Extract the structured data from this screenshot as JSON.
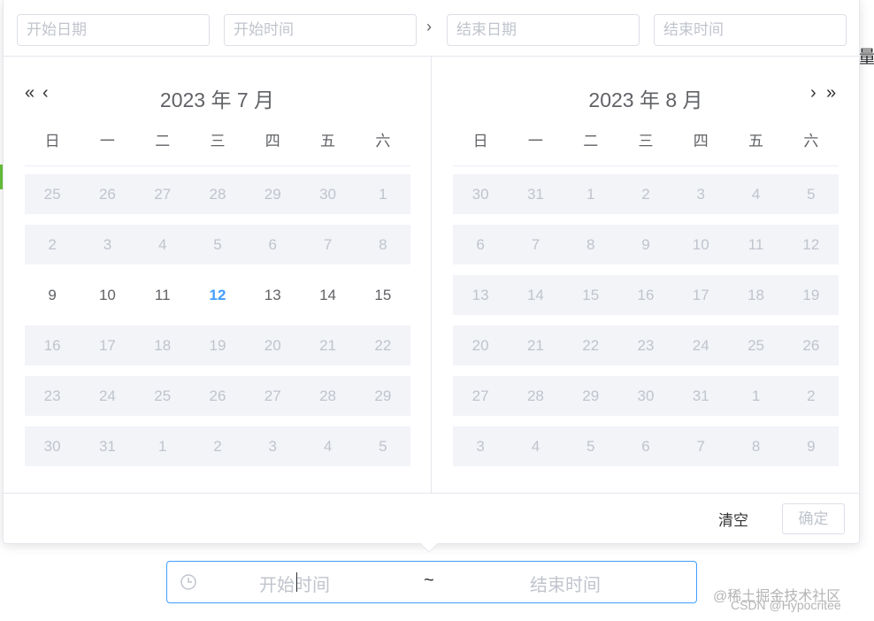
{
  "header": {
    "start_date_placeholder": "开始日期",
    "start_time_placeholder": "开始时间",
    "separator": "›",
    "end_date_placeholder": "结束日期",
    "end_time_placeholder": "结束时间"
  },
  "nav": {
    "prev_year": "«",
    "prev_month": "‹",
    "next_month": "›",
    "next_year": "»"
  },
  "weekdays": [
    "日",
    "一",
    "二",
    "三",
    "四",
    "五",
    "六"
  ],
  "left_calendar": {
    "title": "2023 年 7 月",
    "today": "12",
    "rows": [
      {
        "shaded": true,
        "cells": [
          [
            "25",
            "dim"
          ],
          [
            "26",
            "dim"
          ],
          [
            "27",
            "dim"
          ],
          [
            "28",
            "dim"
          ],
          [
            "29",
            "dim"
          ],
          [
            "30",
            "dim"
          ],
          [
            "1",
            "cur"
          ]
        ]
      },
      {
        "shaded": true,
        "cells": [
          [
            "2",
            "cur"
          ],
          [
            "3",
            "cur"
          ],
          [
            "4",
            "cur"
          ],
          [
            "5",
            "cur"
          ],
          [
            "6",
            "cur"
          ],
          [
            "7",
            "cur"
          ],
          [
            "8",
            "cur"
          ]
        ]
      },
      {
        "shaded": false,
        "cells": [
          [
            "9",
            "cur"
          ],
          [
            "10",
            "cur"
          ],
          [
            "11",
            "cur"
          ],
          [
            "12",
            "today"
          ],
          [
            "13",
            "cur"
          ],
          [
            "14",
            "cur"
          ],
          [
            "15",
            "cur"
          ]
        ]
      },
      {
        "shaded": true,
        "cells": [
          [
            "16",
            "cur"
          ],
          [
            "17",
            "cur"
          ],
          [
            "18",
            "cur"
          ],
          [
            "19",
            "cur"
          ],
          [
            "20",
            "cur"
          ],
          [
            "21",
            "cur"
          ],
          [
            "22",
            "cur"
          ]
        ]
      },
      {
        "shaded": true,
        "cells": [
          [
            "23",
            "cur"
          ],
          [
            "24",
            "cur"
          ],
          [
            "25",
            "cur"
          ],
          [
            "26",
            "cur"
          ],
          [
            "27",
            "cur"
          ],
          [
            "28",
            "cur"
          ],
          [
            "29",
            "cur"
          ]
        ]
      },
      {
        "shaded": true,
        "cells": [
          [
            "30",
            "cur"
          ],
          [
            "31",
            "cur"
          ],
          [
            "1",
            "dim"
          ],
          [
            "2",
            "dim"
          ],
          [
            "3",
            "dim"
          ],
          [
            "4",
            "dim"
          ],
          [
            "5",
            "dim"
          ]
        ]
      }
    ]
  },
  "right_calendar": {
    "title": "2023 年 8 月",
    "rows": [
      {
        "shaded": true,
        "cells": [
          [
            "30",
            "dim"
          ],
          [
            "31",
            "dim"
          ],
          [
            "1",
            "cur"
          ],
          [
            "2",
            "cur"
          ],
          [
            "3",
            "cur"
          ],
          [
            "4",
            "cur"
          ],
          [
            "5",
            "cur"
          ]
        ]
      },
      {
        "shaded": true,
        "cells": [
          [
            "6",
            "cur"
          ],
          [
            "7",
            "cur"
          ],
          [
            "8",
            "cur"
          ],
          [
            "9",
            "cur"
          ],
          [
            "10",
            "cur"
          ],
          [
            "11",
            "cur"
          ],
          [
            "12",
            "cur"
          ]
        ]
      },
      {
        "shaded": true,
        "cells": [
          [
            "13",
            "cur"
          ],
          [
            "14",
            "cur"
          ],
          [
            "15",
            "cur"
          ],
          [
            "16",
            "cur"
          ],
          [
            "17",
            "cur"
          ],
          [
            "18",
            "cur"
          ],
          [
            "19",
            "cur"
          ]
        ]
      },
      {
        "shaded": true,
        "cells": [
          [
            "20",
            "cur"
          ],
          [
            "21",
            "cur"
          ],
          [
            "22",
            "cur"
          ],
          [
            "23",
            "cur"
          ],
          [
            "24",
            "cur"
          ],
          [
            "25",
            "cur"
          ],
          [
            "26",
            "cur"
          ]
        ]
      },
      {
        "shaded": true,
        "cells": [
          [
            "27",
            "cur"
          ],
          [
            "28",
            "cur"
          ],
          [
            "29",
            "cur"
          ],
          [
            "30",
            "cur"
          ],
          [
            "31",
            "cur"
          ],
          [
            "1",
            "dim"
          ],
          [
            "2",
            "dim"
          ]
        ]
      },
      {
        "shaded": true,
        "cells": [
          [
            "3",
            "dim"
          ],
          [
            "4",
            "dim"
          ],
          [
            "5",
            "dim"
          ],
          [
            "6",
            "dim"
          ],
          [
            "7",
            "dim"
          ],
          [
            "8",
            "dim"
          ],
          [
            "9",
            "dim"
          ]
        ]
      }
    ]
  },
  "footer": {
    "clear_label": "清空",
    "confirm_label": "确定"
  },
  "range_input": {
    "start_placeholder": "开始时间",
    "separator": "~",
    "end_placeholder": "结束时间"
  },
  "watermark": {
    "line1": "@稀土掘金技术社区",
    "line2": "CSDN @Hypocritee"
  },
  "colors": {
    "accent": "#409eff",
    "border": "#dcdfe6",
    "shaded_row": "#f2f4f8"
  }
}
